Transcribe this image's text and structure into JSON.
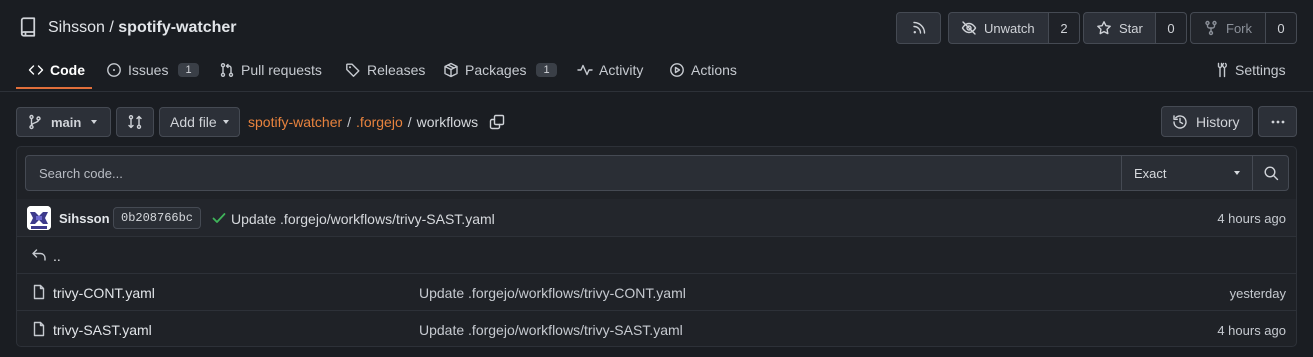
{
  "repo": {
    "owner": "Sihsson",
    "separator": " / ",
    "name": "spotify-watcher"
  },
  "header_actions": {
    "unwatch_label": "Unwatch",
    "unwatch_count": "2",
    "star_label": "Star",
    "star_count": "0",
    "fork_label": "Fork",
    "fork_count": "0"
  },
  "tabs": [
    {
      "label": "Code",
      "icon": "code-icon",
      "active": true
    },
    {
      "label": "Issues",
      "icon": "issue-icon",
      "count": "1"
    },
    {
      "label": "Pull requests",
      "icon": "pull-request-icon"
    },
    {
      "label": "Releases",
      "icon": "tag-icon"
    },
    {
      "label": "Packages",
      "icon": "package-icon",
      "count": "1"
    },
    {
      "label": "Activity",
      "icon": "pulse-icon"
    },
    {
      "label": "Actions",
      "icon": "play-icon"
    },
    {
      "label": "Settings",
      "icon": "tools-icon"
    }
  ],
  "toolbar": {
    "branch": "main",
    "add_file": "Add file",
    "history": "History"
  },
  "breadcrumb": {
    "root": "spotify-watcher",
    "sep1": "/",
    "dir": ".forgejo",
    "sep2": "/",
    "current": "workflows"
  },
  "search": {
    "placeholder": "Search code...",
    "mode": "Exact"
  },
  "latest_commit": {
    "author": "Sihsson",
    "sha": "0b208766bc",
    "message": "Update .forgejo/workflows/trivy-SAST.yaml",
    "time": "4 hours ago"
  },
  "parent_dir": "..",
  "files": [
    {
      "name": "trivy-CONT.yaml",
      "message": "Update .forgejo/workflows/trivy-CONT.yaml",
      "time": "yesterday"
    },
    {
      "name": "trivy-SAST.yaml",
      "message": "Update .forgejo/workflows/trivy-SAST.yaml",
      "time": "4 hours ago"
    }
  ],
  "colors": {
    "accent": "#e16f3b",
    "link": "#e8833e",
    "success": "#3fb45a",
    "background": "#1a1d22"
  }
}
